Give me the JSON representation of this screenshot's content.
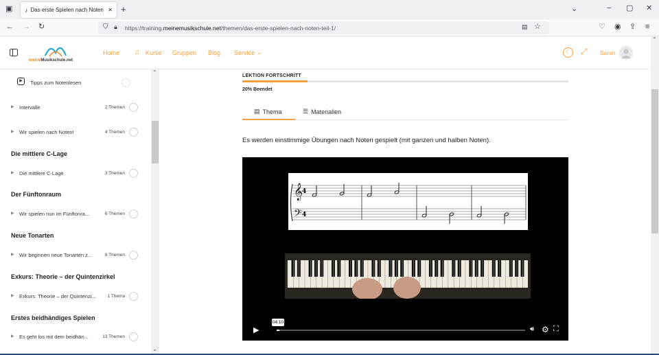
{
  "browser": {
    "tab_title": "Das erste Spielen nach Noten -",
    "url_prefix": "https://training.",
    "url_domain": "meinemusikschule.net",
    "url_path": "/themen/das-erste-spielen-nach-noten-teil-1/"
  },
  "header": {
    "logo_prefix": "meine",
    "logo_name": "Musikschule.net",
    "nav": [
      "Home",
      "Kurse",
      "Gruppen",
      "Blog",
      "Service"
    ],
    "user": "Sarah"
  },
  "sidebar": {
    "items": [
      {
        "label": "Tipps zum Notenlesen",
        "count": ""
      },
      {
        "label": "Intervalle",
        "count": "2 Themen"
      },
      {
        "label": "Wir spielen nach Noten!",
        "count": "4 Themen"
      },
      {
        "label": "Die mittlere C-Lage",
        "count": "3 Themen"
      },
      {
        "label": "Wir spielen nun im Fünftonra...",
        "count": "6 Themen"
      },
      {
        "label": "Wir beginnen neue Tonarten z...",
        "count": "8 Themen"
      },
      {
        "label": "Exkurs: Theorie – der Quintenzi...",
        "count": "1 Thema"
      },
      {
        "label": "Es geht los mit dem beidhän...",
        "count": "13 Themen"
      }
    ],
    "sections": [
      "Die mittlere C-Lage",
      "Der Fünftonraum",
      "Neue Tonarten",
      "Exkurs: Theorie – der Quintenzirkel",
      "Erstes beidhändiges Spielen"
    ]
  },
  "lesson": {
    "progress_title": "LEKTION FORTSCHRITT",
    "progress_value": 0.2,
    "progress_text": "20% Beendet",
    "tabs": [
      "Thema",
      "Materialien"
    ],
    "description": "Es werden einstimmige Übungen nach Noten gespielt (mit ganzen und halben Noten)."
  },
  "video": {
    "time": "04:10",
    "played_fraction": 0.01
  },
  "colors": {
    "accent": "#f5a03c",
    "brand_teal": "#1aa5c8"
  }
}
